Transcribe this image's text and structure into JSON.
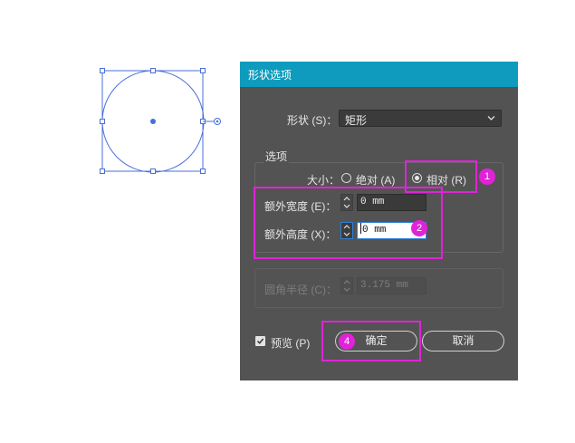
{
  "dialog": {
    "title": "形状选项",
    "shape_label": "形状 (S)：",
    "shape_value": "矩形",
    "options_group_label": "选项",
    "size_label": "大小：",
    "size_options": [
      "绝对 (A)",
      "相对 (R)"
    ],
    "size_selected": "相对 (R)",
    "extra_width_label": "额外宽度 (E)：",
    "extra_width_value": "0 mm",
    "extra_height_label": "额外高度 (X)：",
    "extra_height_value": "0 mm",
    "corner_radius_label": "圆角半径 (C)：",
    "corner_radius_value": "3.175 mm",
    "preview_label": "预览 (P)",
    "preview_checked": true,
    "ok_label": "确定",
    "cancel_label": "取消"
  },
  "annotations": {
    "badges": [
      "1",
      "2",
      "4"
    ],
    "highlight_color": "#e023d8"
  },
  "colors": {
    "titlebar": "#0e9bbd",
    "dialog_bg": "#535353",
    "selection": "#4a6fd8"
  }
}
